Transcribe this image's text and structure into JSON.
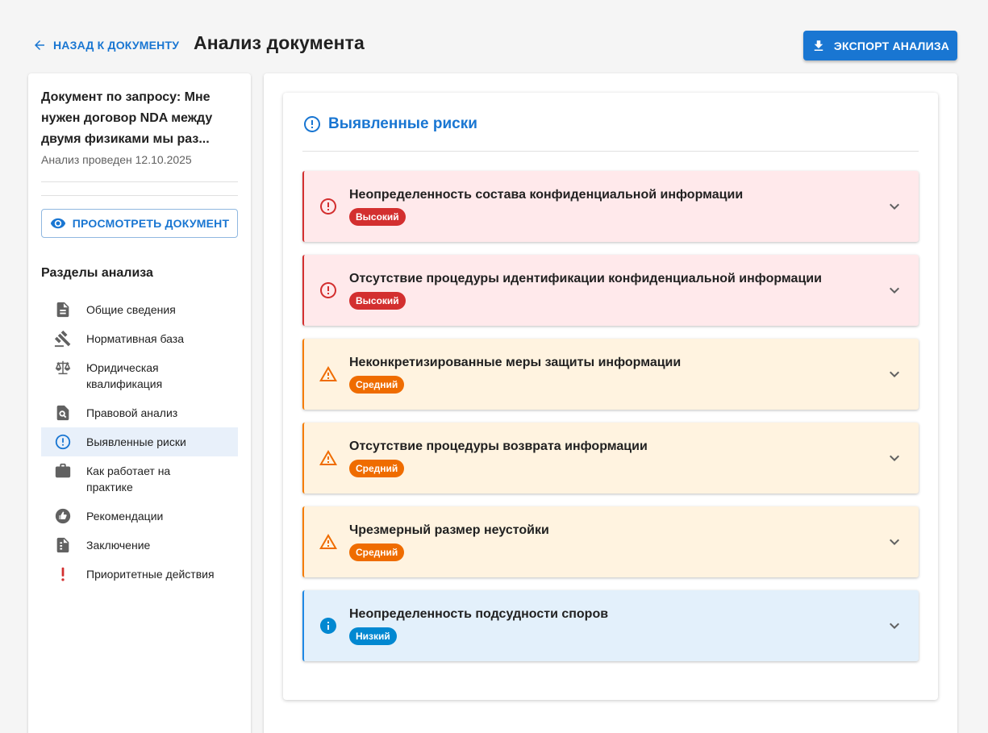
{
  "header": {
    "back_label": "НАЗАД К ДОКУМЕНТУ",
    "title": "Анализ документа",
    "export_label": "ЭКСПОРТ АНАЛИЗА"
  },
  "sidebar": {
    "doc_title": "Документ по запросу: Мне нужен договор NDA между двумя физиками мы раз...",
    "doc_date": "Анализ проведен 12.10.2025",
    "view_label": "ПРОСМОТРЕТЬ ДОКУМЕНТ",
    "sections_title": "Разделы анализа",
    "items": [
      {
        "label": "Общие сведения",
        "icon": "document-icon"
      },
      {
        "label": "Нормативная база",
        "icon": "gavel-icon"
      },
      {
        "label": "Юридическая квалификация",
        "icon": "scales-icon"
      },
      {
        "label": "Правовой анализ",
        "icon": "document-search-icon"
      },
      {
        "label": "Выявленные риски",
        "icon": "alert-circle-icon",
        "active": true
      },
      {
        "label": "Как работает на практике",
        "icon": "briefcase-icon"
      },
      {
        "label": "Рекомендации",
        "icon": "thumb-up-icon"
      },
      {
        "label": "Заключение",
        "icon": "document-check-icon"
      },
      {
        "label": "Приоритетные действия",
        "icon": "exclamation-icon"
      }
    ]
  },
  "risks": {
    "title": "Выявленные риски",
    "items": [
      {
        "title": "Неопределенность состава конфиденциальной информации",
        "level": "Высокий",
        "severity": "high"
      },
      {
        "title": "Отсутствие процедуры идентификации конфиденциальной информации",
        "level": "Высокий",
        "severity": "high"
      },
      {
        "title": "Неконкретизированные меры защиты информации",
        "level": "Средний",
        "severity": "medium"
      },
      {
        "title": "Отсутствие процедуры возврата информации",
        "level": "Средний",
        "severity": "medium"
      },
      {
        "title": "Чрезмерный размер неустойки",
        "level": "Средний",
        "severity": "medium"
      },
      {
        "title": "Неопределенность подсудности споров",
        "level": "Низкий",
        "severity": "low"
      }
    ]
  },
  "colors": {
    "primary": "#1976d2",
    "high": "#d32f2f",
    "medium": "#ef6c00",
    "low": "#0288d1"
  }
}
